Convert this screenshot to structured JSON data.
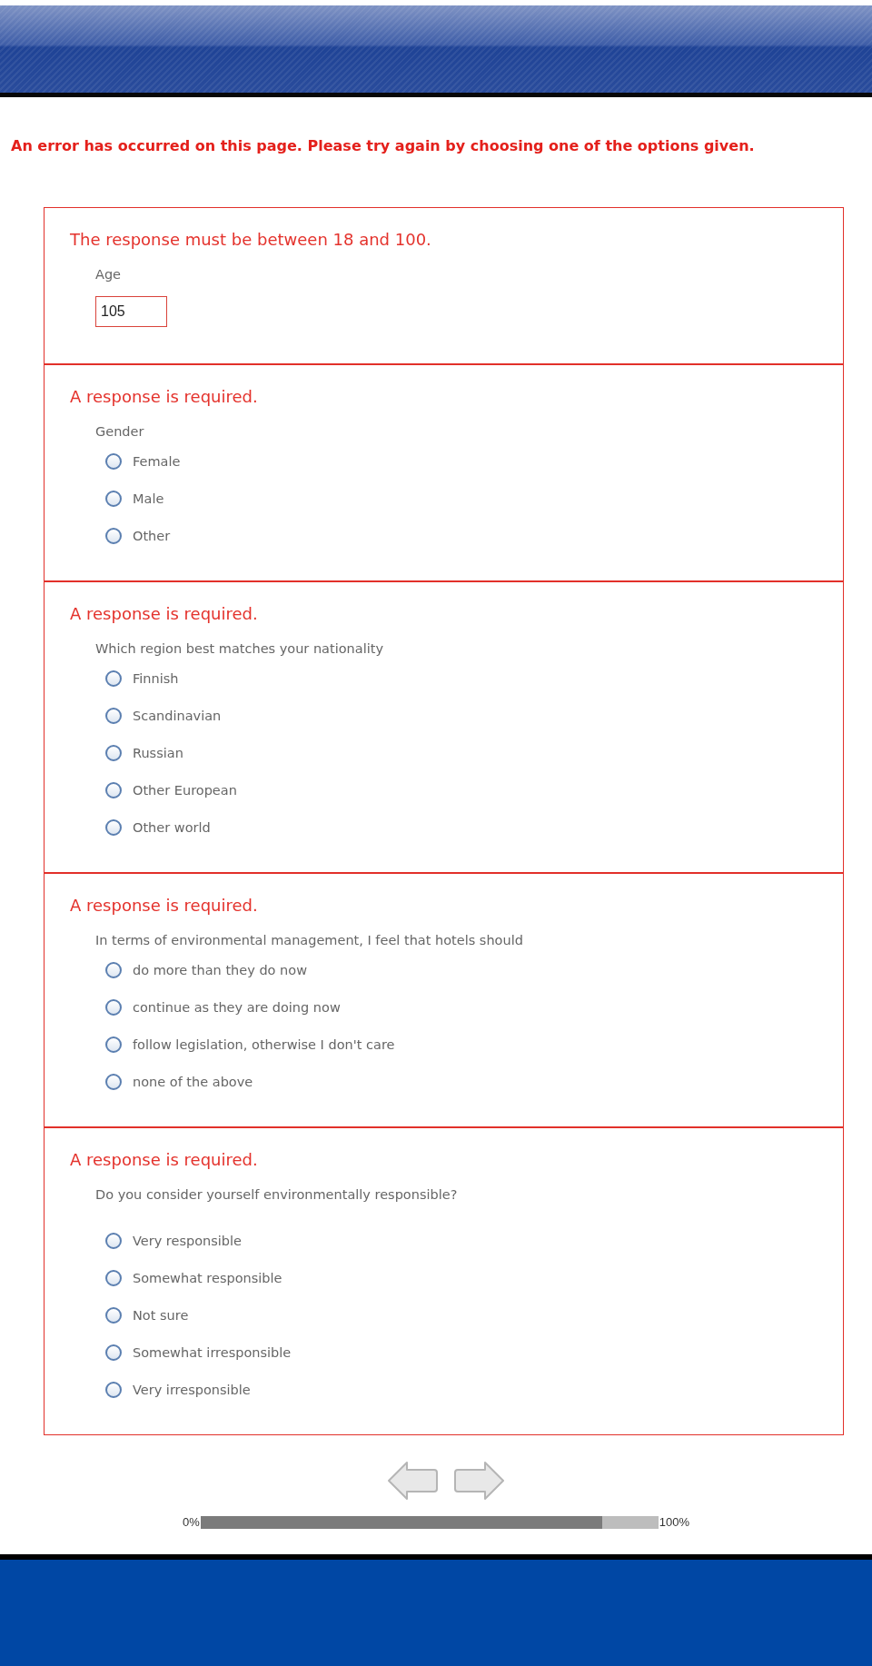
{
  "error_banner": "An error has occurred on this page. Please try again by choosing one of the options given.",
  "questions": [
    {
      "kind": "text",
      "error": "The response must be between 18 and 100.",
      "label": "Age",
      "value": "105"
    },
    {
      "kind": "radio",
      "error": "A response is required.",
      "label": "Gender",
      "options": [
        {
          "label": "Female",
          "selected": false
        },
        {
          "label": "Male",
          "selected": false
        },
        {
          "label": "Other",
          "selected": false
        }
      ]
    },
    {
      "kind": "radio",
      "error": "A response is required.",
      "label": "Which region best matches your nationality",
      "options": [
        {
          "label": "Finnish",
          "selected": false
        },
        {
          "label": "Scandinavian",
          "selected": false
        },
        {
          "label": "Russian",
          "selected": false
        },
        {
          "label": "Other European",
          "selected": false
        },
        {
          "label": "Other world",
          "selected": false
        }
      ]
    },
    {
      "kind": "radio",
      "error": "A response is required.",
      "label": "In terms of environmental management, I feel that hotels should",
      "options": [
        {
          "label": "do more than they do now",
          "selected": false
        },
        {
          "label": "continue as they are doing now",
          "selected": false
        },
        {
          "label": "follow legislation, otherwise I don't care",
          "selected": false
        },
        {
          "label": "none of the above",
          "selected": false
        }
      ]
    },
    {
      "kind": "radio",
      "error": "A response is required.",
      "label": "Do you consider yourself environmentally responsible?",
      "options": [
        {
          "label": "Very responsible",
          "selected": false
        },
        {
          "label": "Somewhat responsible",
          "selected": false
        },
        {
          "label": "Not sure",
          "selected": false
        },
        {
          "label": "Somewhat irresponsible",
          "selected": false
        },
        {
          "label": "Very irresponsible",
          "selected": false
        }
      ]
    }
  ],
  "progress": {
    "start_label": "0%",
    "level": 0.877,
    "end_label": "100%"
  }
}
